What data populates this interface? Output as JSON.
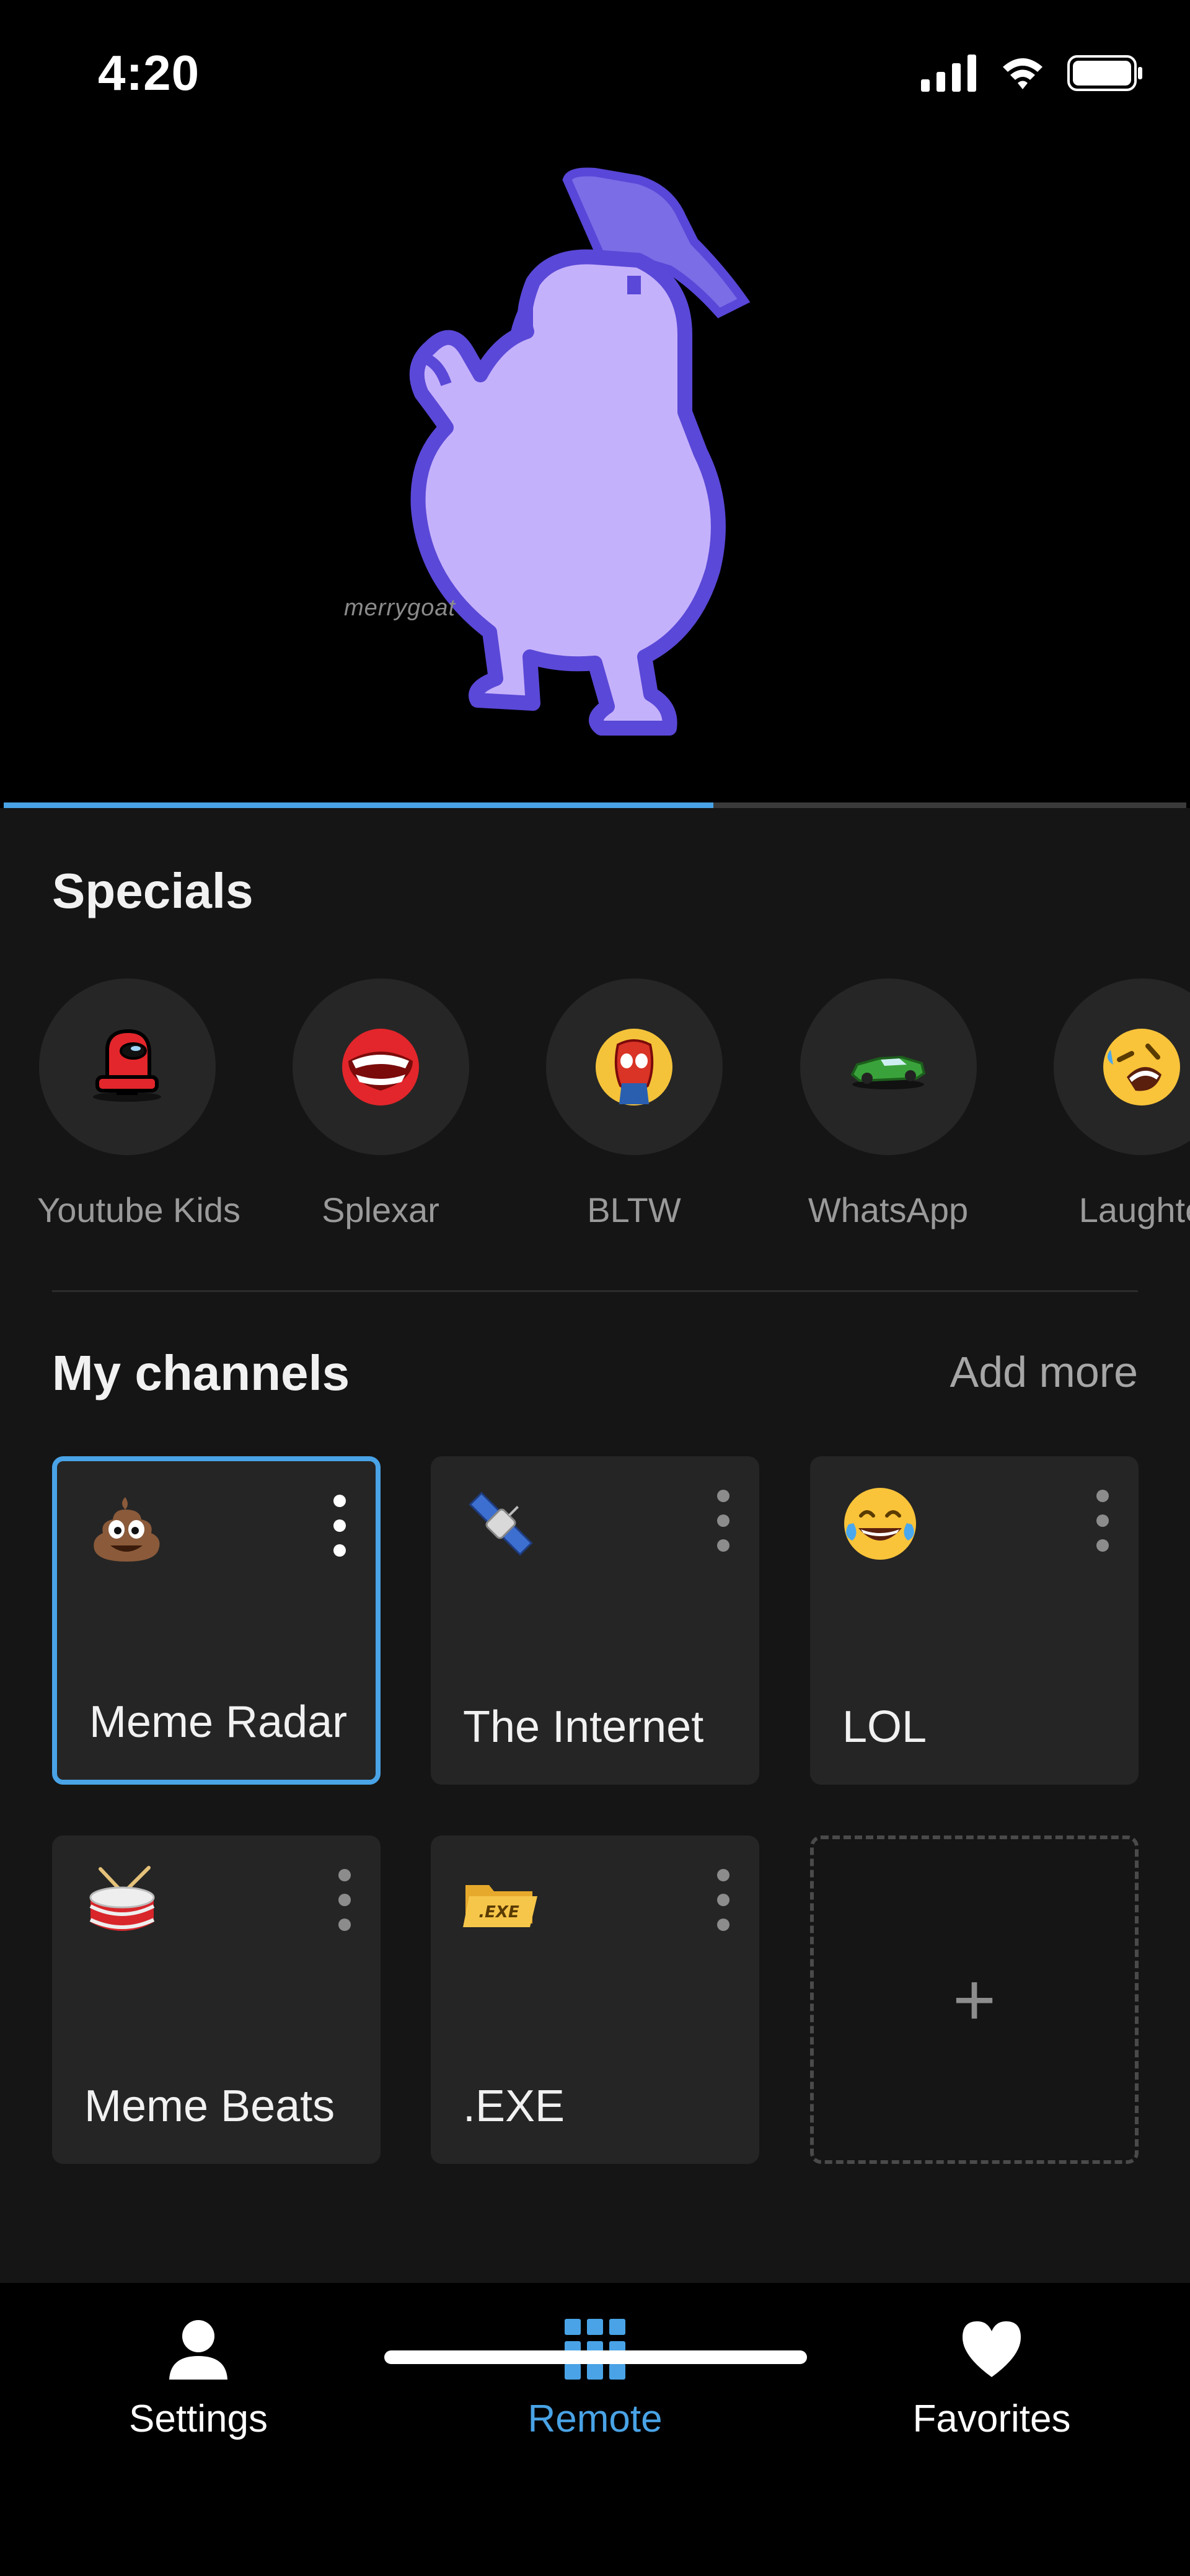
{
  "status_bar": {
    "time": "4:20"
  },
  "hero": {
    "watermark": "merrygoat",
    "progress_percent": 60
  },
  "specials": {
    "title": "Specials",
    "items": [
      {
        "label": "Youtube Kids",
        "icon": "crewmate-icon"
      },
      {
        "label": "Splexar",
        "icon": "mouth-teeth-icon"
      },
      {
        "label": "BLTW",
        "icon": "spider-face-icon"
      },
      {
        "label": "WhatsApp",
        "icon": "green-car-icon"
      },
      {
        "label": "Laughte",
        "icon": "rolling-laugh-emoji-icon"
      }
    ]
  },
  "channels": {
    "title": "My channels",
    "add_more": "Add more",
    "items": [
      {
        "name": "Meme Radar",
        "icon": "poop-emoji-icon",
        "selected": true
      },
      {
        "name": "The Internet",
        "icon": "satellite-emoji-icon"
      },
      {
        "name": "LOL",
        "icon": "tears-of-joy-emoji-icon"
      },
      {
        "name": "Meme Beats",
        "icon": "drum-emoji-icon"
      },
      {
        "name": ".EXE",
        "icon": "exe-folder-icon"
      }
    ],
    "add_card_symbol": "+"
  },
  "tabbar": {
    "settings": "Settings",
    "remote": "Remote",
    "favorites": "Favorites",
    "active": "remote"
  },
  "colors": {
    "accent": "#49a3e6",
    "card": "#252525",
    "panel": "#151515",
    "duck": "#c4b1fb"
  }
}
